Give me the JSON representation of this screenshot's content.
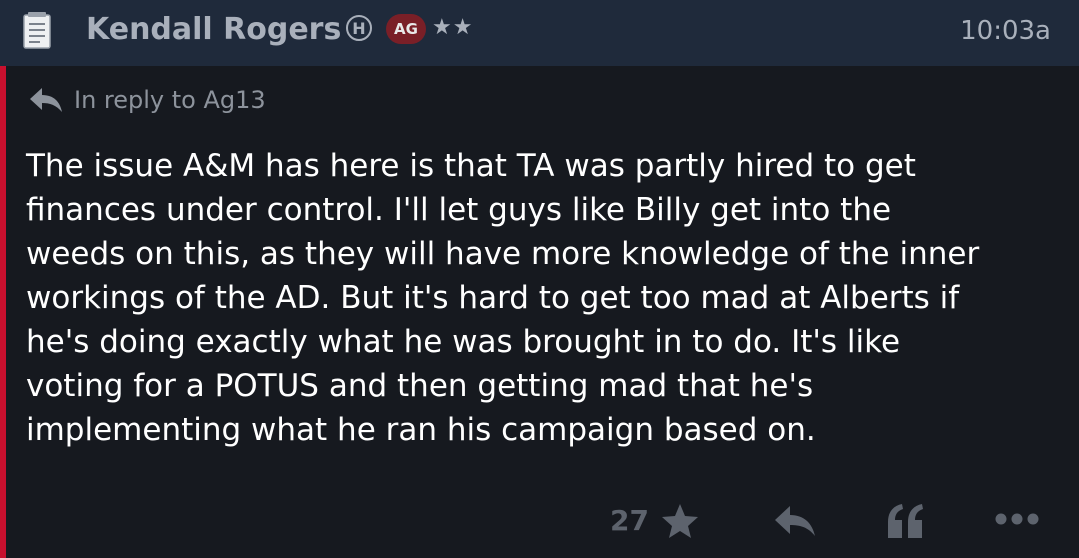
{
  "post": {
    "author": "Kendall Rogers",
    "h_badge": "H",
    "ag_badge": "AG",
    "stars": "★★",
    "time": "10:03a",
    "reply_to": "In reply to Ag13",
    "body": "The issue A&M has here is that TA was partly hired to get\nfinances under control. I'll let guys like Billy get into the\nweeds on this, as they will have more knowledge of the inner\nworkings of the AD. But it's hard to get too mad at Alberts if\nhe's doing exactly what he was brought in to do. It's like\nvoting for a POTUS and then getting mad that he's\nimplementing what he ran his campaign based on.",
    "score": "27"
  },
  "colors": {
    "accent": "#c8102e",
    "header_bg": "#1f2a3b",
    "page_bg": "#16191f",
    "badge_bg": "#7a1f27",
    "muted": "#a9b0bb",
    "action_icons": "#5d636d"
  },
  "icons": {
    "post_type": "document-icon",
    "reply_to": "reply-arrow-icon",
    "rate": "star-icon",
    "reply": "reply-icon",
    "quote": "quote-icon",
    "more": "more-dots-icon"
  }
}
